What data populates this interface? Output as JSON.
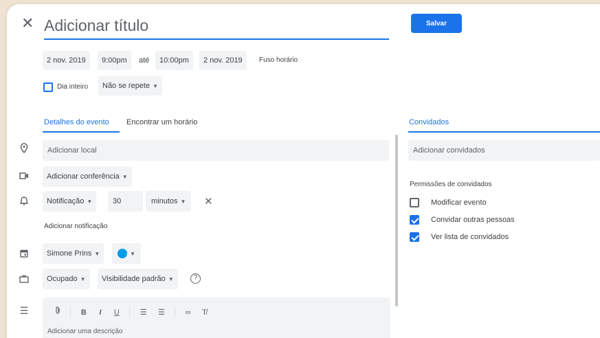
{
  "header": {
    "close_icon": "close-icon",
    "title_placeholder": "Adicionar título",
    "save_label": "Salvar"
  },
  "datetime": {
    "start_date": "2 nov. 2019",
    "start_time": "9:00pm",
    "until": "até",
    "end_time": "10:00pm",
    "end_date": "2 nov. 2019",
    "timezone": "Fuso horário"
  },
  "options": {
    "all_day_label": "Dia inteiro",
    "all_day_checked": false,
    "repeat_label": "Não se repete"
  },
  "tabs": {
    "details": "Detalhes do evento",
    "find_time": "Encontrar um horário",
    "guests": "Convidados"
  },
  "details": {
    "location_placeholder": "Adicionar local",
    "conference": "Adicionar conferência",
    "notification_type": "Notificação",
    "notification_value": "30",
    "notification_unit": "minutos",
    "add_notification": "Adicionar notificação",
    "calendar_owner": "Simone Prins",
    "calendar_color": "#039be5",
    "availability": "Ocupado",
    "visibility": "Visibilidade padrão",
    "description_placeholder": "Adicionar uma descrição"
  },
  "toolbar": {
    "bold": "B",
    "italic": "I",
    "underline": "U"
  },
  "guests": {
    "add_placeholder": "Adicionar convidados",
    "permissions_title": "Permissões de convidados",
    "permissions": [
      {
        "label": "Modificar evento",
        "checked": false
      },
      {
        "label": "Convidar outras pessoas",
        "checked": true
      },
      {
        "label": "Ver lista de convidados",
        "checked": true
      }
    ]
  },
  "colors": {
    "accent": "#1a73e8",
    "background": "#efe3d2"
  }
}
